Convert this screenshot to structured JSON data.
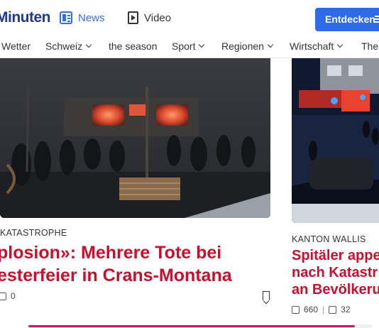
{
  "header": {
    "logo": "Minuten",
    "nav": [
      {
        "label": "News",
        "icon": "newspaper-icon",
        "active": true
      },
      {
        "label": "Video",
        "icon": "video-play-icon",
        "active": false
      }
    ],
    "cta_label": "Entdecken",
    "accent": "#2e6be6"
  },
  "categories": [
    {
      "label": "Wetter",
      "dropdown": false
    },
    {
      "label": "Schweiz",
      "dropdown": true
    },
    {
      "label": "the season",
      "dropdown": false
    },
    {
      "label": "Sport",
      "dropdown": true
    },
    {
      "label": "Regionen",
      "dropdown": true
    },
    {
      "label": "Wirtschaft",
      "dropdown": true
    },
    {
      "label": "The",
      "dropdown": false
    }
  ],
  "articles": [
    {
      "kicker": "KATASTROPHE",
      "headline_line1": "plosion»: Mehrere Tote bei",
      "headline_line2": "esterfeier in Crans-Montana",
      "likes": "0"
    },
    {
      "kicker": "KANTON WALLIS",
      "headline_line1": "Spitäler appe",
      "headline_line2": "nach Katastr",
      "headline_line3": "an Bevölkeru",
      "likes": "660",
      "shares": "32"
    }
  ],
  "colors": {
    "headline": "#c8102e",
    "scroll_accent": "#c11f60"
  }
}
